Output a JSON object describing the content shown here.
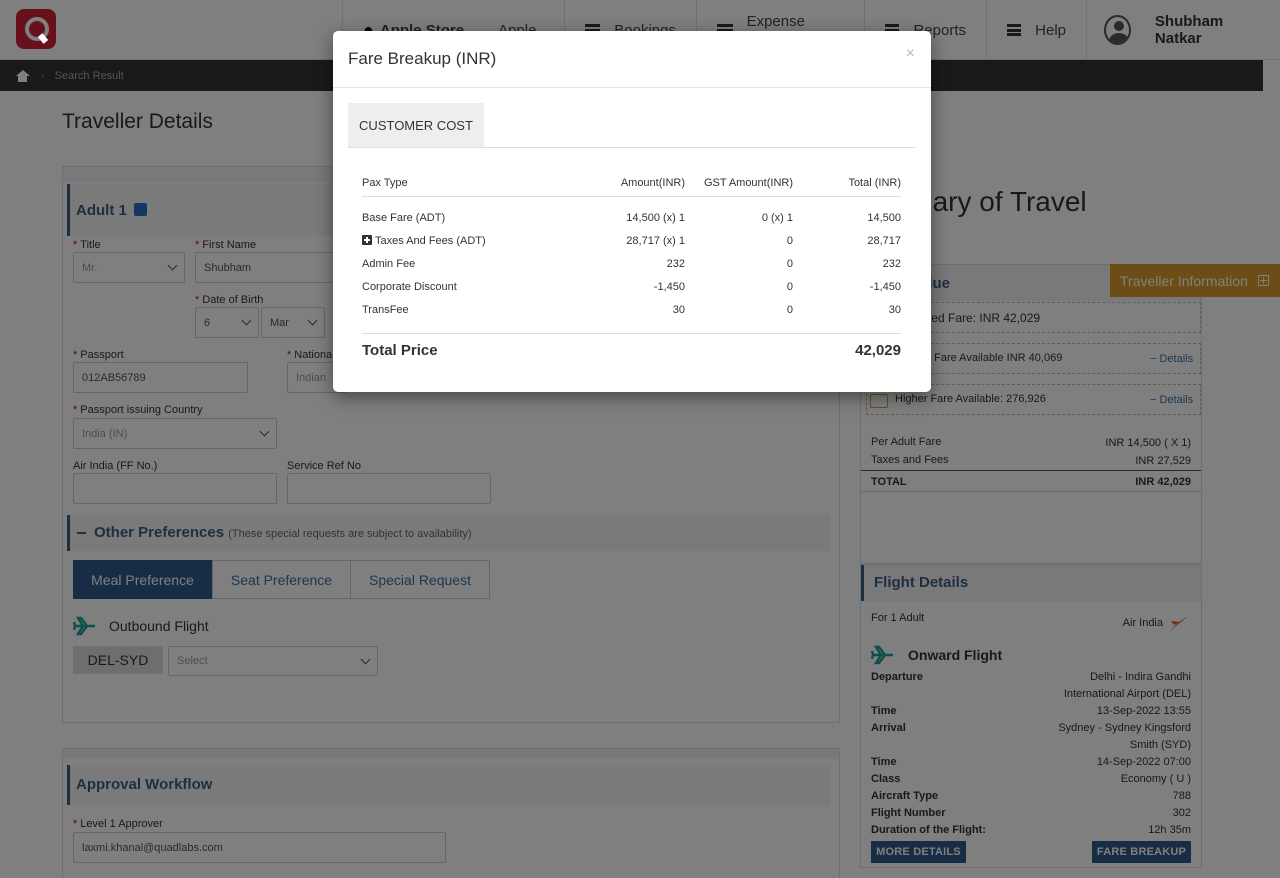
{
  "header": {
    "nav": [
      {
        "label": "Apple Store",
        "icon": "apple-icon"
      },
      {
        "label": "Apple"
      },
      {
        "label": "Bookings",
        "icon": "menu-icon"
      },
      {
        "label": "Expense Mgmt",
        "icon": "menu-icon"
      },
      {
        "label": "Reports",
        "icon": "reports-icon"
      },
      {
        "label": "Help",
        "icon": "menu-icon"
      }
    ],
    "user_name": "Shubham Natkar"
  },
  "breadcrumb": {
    "current": "Search Result"
  },
  "page": {
    "title": "Traveller Details",
    "adult": {
      "heading": "Adult 1",
      "title_label": "Title",
      "title_value": "Mr.",
      "first_name_label": "First Name",
      "first_name_value": "Shubham",
      "dob_label": "Date of Birth",
      "dob_day": "6",
      "dob_month": "Mar",
      "passport_label": "Passport",
      "passport_value": "012AB56789",
      "nationality_label": "Nationa",
      "nationality_value": "Indian",
      "passport_country_label": "Passport issuing Country",
      "passport_country_value": "India (IN)",
      "ff_label": "Air India (FF No.)",
      "service_ref_label": "Service Ref No"
    },
    "other_prefs": {
      "title": "Other Preferences",
      "note": "(These special requests are subject to availability)",
      "tabs": [
        "Meal Preference",
        "Seat Preference",
        "Special Request"
      ],
      "outbound_label": "Outbound Flight",
      "route": "DEL-SYD",
      "meal_select": "Select"
    },
    "approval": {
      "title": "Approval Workflow",
      "level1_label": "Level 1 Approver",
      "level1_value": "laxmi.khanal@quadlabs.com"
    }
  },
  "summary": {
    "title": "Summary of Travel",
    "partial_title": "nary of Travel",
    "value_heading": "alue",
    "selected_fare": "ted Fare: INR 42,029",
    "lower_fare": "t Fare Available INR 40,069",
    "higher_fare": "Higher Fare Available: 276,926",
    "details_link": "− Details",
    "per_adult_label": "Per Adult Fare",
    "per_adult_value": "INR 14,500 ( X 1)",
    "taxes_label": "Taxes and Fees",
    "taxes_value": "INR 27,529",
    "total_label": "TOTAL",
    "total_value": "INR 42,029",
    "traveller_info_tab": "Traveller Information"
  },
  "flight_details": {
    "title": "Flight Details",
    "for_adults": "For 1 Adult",
    "airline": "Air India",
    "onward": "Onward Flight",
    "rows": [
      {
        "label": "Departure",
        "value": "Delhi - Indira Gandhi International Airport (DEL)"
      },
      {
        "label": "Time",
        "value": "13-Sep-2022 13:55"
      },
      {
        "label": "Arrival",
        "value": "Sydney - Sydney Kingsford Smith (SYD)"
      },
      {
        "label": "Time",
        "value": "14-Sep-2022 07:00"
      },
      {
        "label": "Class",
        "value": "Economy ( U )"
      },
      {
        "label": "Aircraft Type",
        "value": "788"
      },
      {
        "label": "Flight Number",
        "value": "302"
      },
      {
        "label": "Duration of the Flight:",
        "value": "12h 35m"
      }
    ],
    "more_details": "MORE DETAILS",
    "fare_breakup": "FARE BREAKUP"
  },
  "modal": {
    "title": "Fare Breakup (INR)",
    "close": "×",
    "tab": "CUSTOMER COST",
    "columns": [
      "Pax Type",
      "Amount(INR)",
      "GST Amount(INR)",
      "Total (INR)"
    ],
    "rows": [
      {
        "type": "Base Fare (ADT)",
        "amount": "14,500 (x) 1",
        "gst": "0 (x) 1",
        "total": "14,500"
      },
      {
        "type": "Taxes And Fees (ADT)",
        "amount": "28,717 (x) 1",
        "gst": "0",
        "total": "28,717",
        "expandable": true
      },
      {
        "type": "Admin Fee",
        "amount": "232",
        "gst": "0",
        "total": "232"
      },
      {
        "type": "Corporate Discount",
        "amount": "-1,450",
        "gst": "0",
        "total": "-1,450"
      },
      {
        "type": "TransFee",
        "amount": "30",
        "gst": "0",
        "total": "30"
      }
    ],
    "total_label": "Total Price",
    "total_value": "42,029"
  }
}
